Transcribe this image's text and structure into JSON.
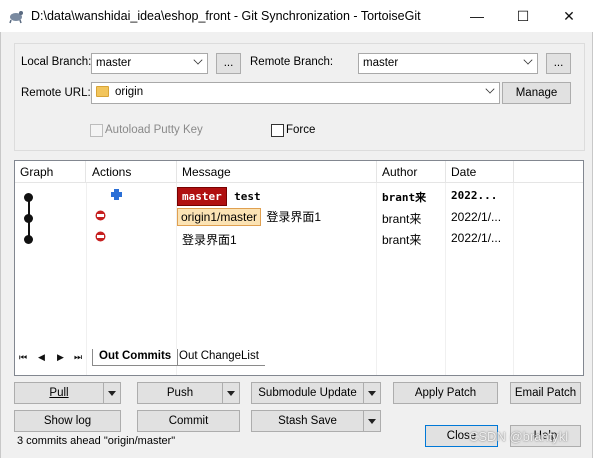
{
  "window": {
    "title": "D:\\data\\wanshidai_idea\\eshop_front - Git Synchronization - TortoiseGit",
    "minimize_glyph": "—",
    "maximize_glyph": "☐",
    "close_glyph": "✕"
  },
  "branches": {
    "local_label": "Local Branch:",
    "local_value": "master",
    "local_browse": "...",
    "remote_label": "Remote Branch:",
    "remote_value": "master",
    "remote_browse": "...",
    "url_label": "Remote URL:",
    "url_value": "origin",
    "manage_label": "Manage"
  },
  "options": {
    "autoload_label": "Autoload Putty Key",
    "force_label": "Force"
  },
  "log": {
    "columns": [
      "Graph",
      "Actions",
      "Message",
      "Author",
      "Date"
    ],
    "rows": [
      {
        "tag": "master",
        "message": "test",
        "author": "brant来",
        "date": "2022..."
      },
      {
        "tag": "origin1/master",
        "message": "登录界面1",
        "author": "brant来",
        "date": "2022/1/..."
      },
      {
        "tag": "",
        "message": "登录界面1",
        "author": "brant来",
        "date": "2022/1/..."
      }
    ]
  },
  "tabs": {
    "nav_first": "⏮",
    "nav_prev": "◀",
    "nav_next": "▶",
    "nav_last": "⏭",
    "out_commits": "Out Commits",
    "out_changelist": "Out ChangeList"
  },
  "buttons": {
    "pull": "Pull",
    "push": "Push",
    "submodule_update": "Submodule Update",
    "apply_patch": "Apply Patch",
    "email_patch": "Email Patch",
    "show_log": "Show log",
    "commit": "Commit",
    "stash_save": "Stash Save",
    "close": "Close",
    "help": "Help"
  },
  "status": {
    "text": "3 commits ahead \"origin/master\"",
    "watermark": "CSDN @brantykl"
  }
}
